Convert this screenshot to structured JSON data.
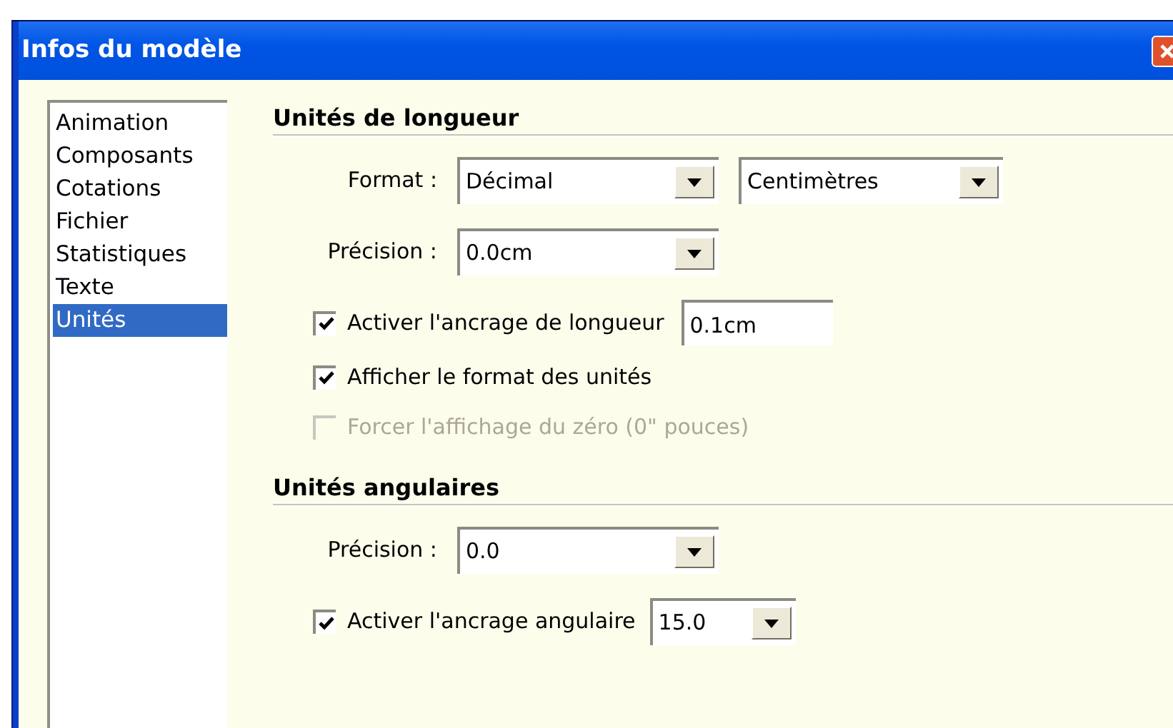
{
  "window": {
    "title": "Infos du modèle"
  },
  "sidebar": {
    "items": [
      {
        "label": "Animation",
        "selected": false
      },
      {
        "label": "Composants",
        "selected": false
      },
      {
        "label": "Cotations",
        "selected": false
      },
      {
        "label": "Fichier",
        "selected": false
      },
      {
        "label": "Statistiques",
        "selected": false
      },
      {
        "label": "Texte",
        "selected": false
      },
      {
        "label": "Unités",
        "selected": true
      }
    ]
  },
  "sections": [
    {
      "title": "Unités de longueur",
      "rows": [
        {
          "kind": "select",
          "label": "Format :",
          "selects": [
            {
              "value": "Décimal"
            },
            {
              "value": "Centimètres"
            }
          ]
        },
        {
          "kind": "select",
          "label": "Précision :",
          "selects": [
            {
              "value": "0.0cm"
            }
          ]
        },
        {
          "kind": "checkbox",
          "label": "Activer l'ancrage de longueur",
          "checked": true,
          "disabled": false,
          "input": {
            "value": "0.1cm"
          }
        },
        {
          "kind": "checkbox",
          "label": "Afficher le format des unités",
          "checked": true,
          "disabled": false
        },
        {
          "kind": "checkbox",
          "label": "Forcer l'affichage du zéro (0\" pouces)",
          "checked": false,
          "disabled": true
        }
      ]
    },
    {
      "title": "Unités angulaires",
      "rows": [
        {
          "kind": "select",
          "label": "Précision :",
          "selects": [
            {
              "value": "0.0"
            }
          ]
        },
        {
          "kind": "checkbox",
          "label": "Activer l'ancrage angulaire",
          "checked": true,
          "disabled": false,
          "select": {
            "value": "15.0"
          }
        }
      ]
    }
  ]
}
